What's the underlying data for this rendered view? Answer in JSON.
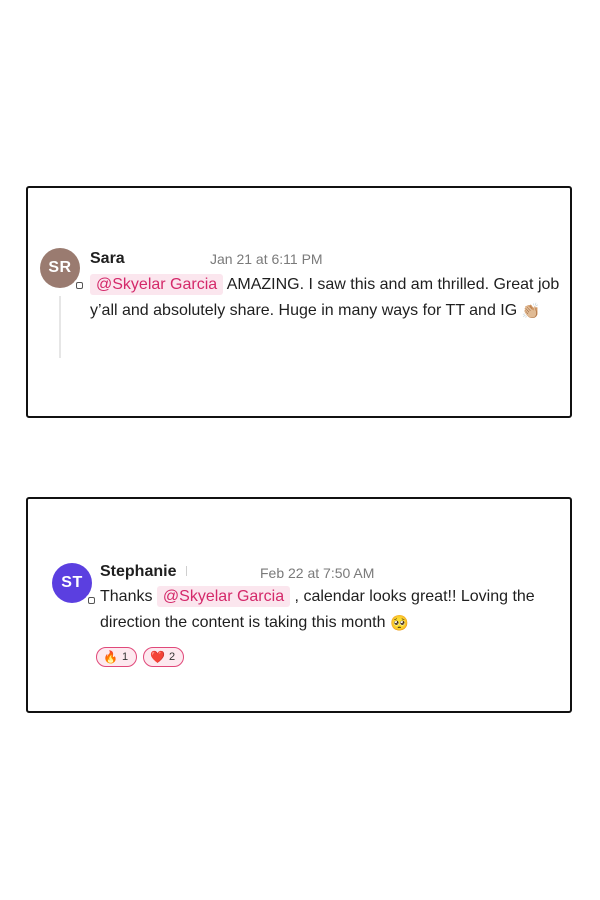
{
  "comments": [
    {
      "avatar_initials": "SR",
      "avatar_color": "#9a7b70",
      "author": "Sara",
      "timestamp": "Jan 21 at 6:11 PM",
      "mention": "@Skyelar Garcia",
      "text_after_mention": "AMAZING. I saw this and am thrilled. Great job y’all and absolutely share. Huge in many ways for TT and IG",
      "trailing_emoji": "👏🏼"
    },
    {
      "avatar_initials": "ST",
      "avatar_color": "#5b3fe0",
      "author": "Stephanie",
      "timestamp": "Feb 22 at 7:50 AM",
      "text_before_mention": "Thanks",
      "mention": "@Skyelar Garcia",
      "text_after_mention": ", calendar looks great!! Loving the direction the content is taking this month",
      "trailing_emoji": "🥺",
      "reactions": [
        {
          "emoji": "🔥",
          "count": "1"
        },
        {
          "emoji": "❤️",
          "count": "2"
        }
      ]
    }
  ],
  "colors": {
    "mention_text": "#d4296a",
    "mention_bg": "#fbe6ee",
    "reaction_border": "#e0487a"
  }
}
